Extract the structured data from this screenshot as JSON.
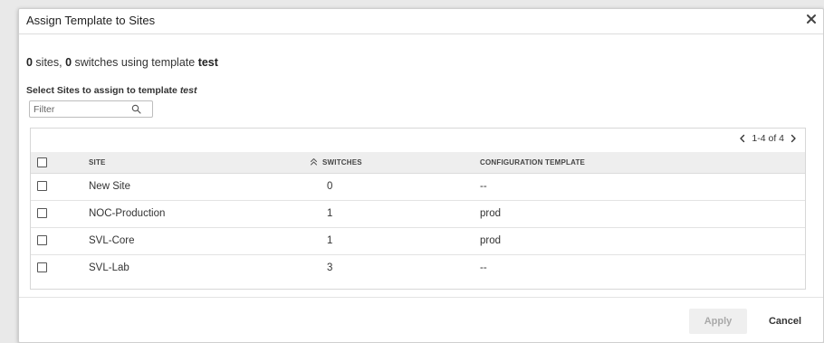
{
  "dialog": {
    "title": "Assign Template to Sites",
    "close_icon": "close-icon"
  },
  "summary": {
    "sites_count": "0",
    "sites_text": " sites, ",
    "switches_count": "0",
    "switches_text": " switches using template ",
    "template_name": "test"
  },
  "select_label": {
    "prefix": "Select Sites to assign to template ",
    "template_name": "test"
  },
  "filter": {
    "placeholder": "Filter",
    "value": "",
    "icon": "search-icon"
  },
  "pagination": {
    "text": "1-4 of 4"
  },
  "table": {
    "headers": {
      "site": "SITE",
      "switches": "SWITCHES",
      "configuration_template": "CONFIGURATION TEMPLATE"
    },
    "rows": [
      {
        "site": "New Site",
        "switches": "0",
        "configuration_template": "--"
      },
      {
        "site": "NOC-Production",
        "switches": "1",
        "configuration_template": "prod"
      },
      {
        "site": "SVL-Core",
        "switches": "1",
        "configuration_template": "prod"
      },
      {
        "site": "SVL-Lab",
        "switches": "3",
        "configuration_template": "--"
      }
    ]
  },
  "buttons": {
    "apply": "Apply",
    "cancel": "Cancel"
  }
}
